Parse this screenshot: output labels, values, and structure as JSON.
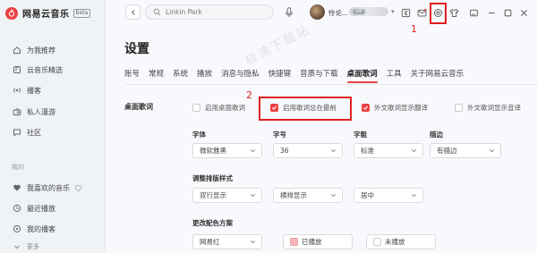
{
  "app": {
    "name": "网易云音乐",
    "badge": "Beta"
  },
  "sidebar": {
    "items": [
      {
        "label": "为我推荐",
        "icon": "home-icon"
      },
      {
        "label": "云音乐精选",
        "icon": "music-note-icon"
      },
      {
        "label": "播客",
        "icon": "podcast-icon"
      },
      {
        "label": "私人漫游",
        "icon": "radio-icon"
      },
      {
        "label": "社区",
        "icon": "chat-icon"
      }
    ],
    "section_label": "我的",
    "my_items": [
      {
        "label": "我喜欢的音乐",
        "icon": "heart-icon"
      },
      {
        "label": "最近播放",
        "icon": "clock-icon"
      },
      {
        "label": "我的播客",
        "icon": "podcast-icon"
      },
      {
        "label": "更多",
        "icon": "chevron-down-icon"
      }
    ]
  },
  "topbar": {
    "search_placeholder": "Linkin Park",
    "username": "怜论...",
    "vip_badge": "VIP"
  },
  "annotations": {
    "one": "1",
    "two": "2"
  },
  "watermark": "极速下载站",
  "page": {
    "title": "设置",
    "tabs": [
      "账号",
      "常规",
      "系统",
      "播放",
      "消息与隐私",
      "快捷键",
      "音质与下载",
      "桌面歌词",
      "工具",
      "关于网易云音乐"
    ],
    "active_tab": "桌面歌词"
  },
  "lyrics": {
    "section_title": "桌面歌词",
    "checkboxes": [
      {
        "label": "启用桌面歌词",
        "checked": false
      },
      {
        "label": "启用歌词总在最前",
        "checked": true
      },
      {
        "label": "外文歌词显示翻译",
        "checked": true
      },
      {
        "label": "外文歌词显示音译",
        "checked": false
      }
    ],
    "font_label": "字体",
    "font_value": "微软雅黑",
    "size_label": "字号",
    "size_value": "36",
    "weight_label": "字粗",
    "weight_value": "标准",
    "stroke_label": "描边",
    "stroke_value": "有描边",
    "layout_label": "调整排版样式",
    "layout_value": "双行显示",
    "orientation_value": "横排显示",
    "align_value": "居中",
    "color_label": "更改配色方案",
    "color_scheme_value": "网易红",
    "played_label": "已播放",
    "played_color": "#f6b8b8",
    "unplayed_label": "未播放",
    "unplayed_color": "#ffffff"
  },
  "colors": {
    "accent": "#ec4141",
    "annotation": "#e02020"
  }
}
